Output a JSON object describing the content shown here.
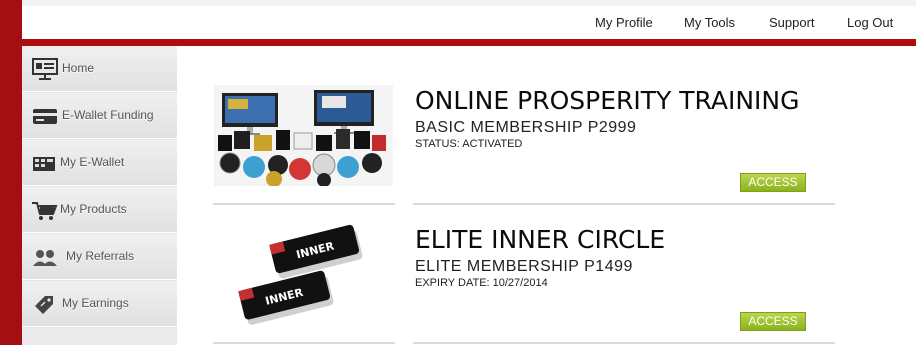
{
  "topnav": {
    "items": [
      "My Profile",
      "My Tools",
      "Support",
      "Log Out"
    ]
  },
  "sidebar": {
    "items": [
      {
        "label": "Home",
        "icon": "presentation-icon"
      },
      {
        "label": "E-Wallet Funding",
        "icon": "credit-card-icon"
      },
      {
        "label": "My E-Wallet",
        "icon": "wallet-icon"
      },
      {
        "label": "My Products",
        "icon": "shopping-cart-icon"
      },
      {
        "label": "My Referrals",
        "icon": "users-icon"
      },
      {
        "label": "My Earnings",
        "icon": "money-tag-icon"
      }
    ]
  },
  "products": [
    {
      "title": "ONLINE PROSPERITY TRAINING",
      "subtitle": "BASIC MEMBERSHIP P2999",
      "status": "STATUS: ACTIVATED",
      "button": "ACCESS"
    },
    {
      "title": "ELITE INNER CIRCLE",
      "subtitle": "ELITE MEMBERSHIP P1499",
      "status": "EXPIRY DATE: 10/27/2014",
      "button": "ACCESS",
      "card_text": "INNER"
    }
  ],
  "colors": {
    "brand_red": "#b00c0c",
    "access_green": "#9dc22c"
  }
}
